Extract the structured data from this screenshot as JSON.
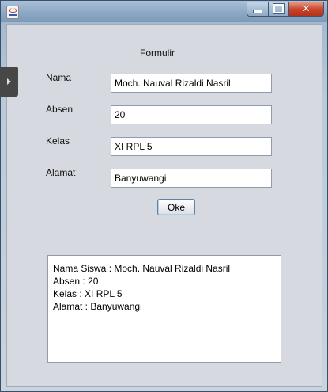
{
  "window": {
    "title": "",
    "controls": [
      "minimize-icon",
      "maximize-icon",
      "close-icon"
    ]
  },
  "form": {
    "title": "Formulir",
    "fields": {
      "nama": {
        "label": "Nama",
        "value": "Moch. Nauval Rizaldi Nasril"
      },
      "absen": {
        "label": "Absen",
        "value": "20"
      },
      "kelas": {
        "label": "Kelas",
        "value": "XI RPL 5"
      },
      "alamat": {
        "label": "Alamat",
        "value": "Banyuwangi"
      }
    },
    "ok_label": "Oke"
  },
  "output": {
    "lines": [
      "Nama Siswa : Moch. Nauval Rizaldi Nasril",
      "Absen : 20",
      "Kelas : XI RPL 5",
      "Alamat : Banyuwangi"
    ]
  },
  "colors": {
    "window_frame": "#8faac6",
    "close_button": "#c8432a",
    "content_bg": "#d6d9df"
  }
}
